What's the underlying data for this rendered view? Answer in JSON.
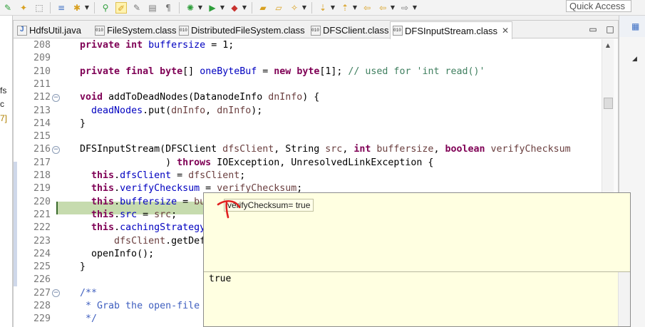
{
  "toolbar": {
    "quick_access_label": "Quick Access"
  },
  "left_panel": {
    "items": [
      "fs",
      "c",
      "7]"
    ]
  },
  "tabs": [
    {
      "label": "HdfsUtil.java",
      "kind": "java",
      "active": false
    },
    {
      "label": "FileSystem.class",
      "kind": "class",
      "active": false
    },
    {
      "label": "DistributedFileSystem.class",
      "kind": "class",
      "active": false
    },
    {
      "label": "DFSClient.class",
      "kind": "class",
      "active": false
    },
    {
      "label": "DFSInputStream.class",
      "kind": "class",
      "active": true,
      "close": "✕"
    }
  ],
  "editor": {
    "line_numbers": [
      "208",
      "209",
      "210",
      "211",
      "212",
      "213",
      "214",
      "215",
      "216",
      "217",
      "218",
      "219",
      "220",
      "221",
      "222",
      "223",
      "224",
      "225",
      "226",
      "227",
      "228",
      "229"
    ],
    "folded_lines": [
      "212",
      "216",
      "227"
    ],
    "highlighted_line": "219",
    "lines": [
      [
        {
          "t": "  "
        },
        {
          "t": "private",
          "c": "kw"
        },
        {
          "t": " "
        },
        {
          "t": "int",
          "c": "kw"
        },
        {
          "t": " "
        },
        {
          "t": "buffersize",
          "c": "fld"
        },
        {
          "t": " = 1;"
        }
      ],
      [
        {
          "t": ""
        }
      ],
      [
        {
          "t": "  "
        },
        {
          "t": "private",
          "c": "kw"
        },
        {
          "t": " "
        },
        {
          "t": "final",
          "c": "kw"
        },
        {
          "t": " "
        },
        {
          "t": "byte",
          "c": "kw"
        },
        {
          "t": "[] "
        },
        {
          "t": "oneByteBuf",
          "c": "fld"
        },
        {
          "t": " = "
        },
        {
          "t": "new",
          "c": "kw"
        },
        {
          "t": " "
        },
        {
          "t": "byte",
          "c": "kw"
        },
        {
          "t": "[1]; "
        },
        {
          "t": "// used for 'int read()'",
          "c": "cmt"
        }
      ],
      [
        {
          "t": ""
        }
      ],
      [
        {
          "t": "  "
        },
        {
          "t": "void",
          "c": "kw"
        },
        {
          "t": " addToDeadNodes(DatanodeInfo "
        },
        {
          "t": "dnInfo",
          "c": "prm"
        },
        {
          "t": ") {"
        }
      ],
      [
        {
          "t": "    "
        },
        {
          "t": "deadNodes",
          "c": "fld"
        },
        {
          "t": ".put("
        },
        {
          "t": "dnInfo",
          "c": "prm"
        },
        {
          "t": ", "
        },
        {
          "t": "dnInfo",
          "c": "prm"
        },
        {
          "t": ");"
        }
      ],
      [
        {
          "t": "  }"
        }
      ],
      [
        {
          "t": ""
        }
      ],
      [
        {
          "t": "  DFSInputStream(DFSClient "
        },
        {
          "t": "dfsClient",
          "c": "prm"
        },
        {
          "t": ", String "
        },
        {
          "t": "src",
          "c": "prm"
        },
        {
          "t": ", "
        },
        {
          "t": "int",
          "c": "kw"
        },
        {
          "t": " "
        },
        {
          "t": "buffersize",
          "c": "prm"
        },
        {
          "t": ", "
        },
        {
          "t": "boolean",
          "c": "kw"
        },
        {
          "t": " "
        },
        {
          "t": "verifyChecksum",
          "c": "prm"
        }
      ],
      [
        {
          "t": "                 ) "
        },
        {
          "t": "throws",
          "c": "kw"
        },
        {
          "t": " IOException, UnresolvedLinkException {"
        }
      ],
      [
        {
          "t": "    "
        },
        {
          "t": "this",
          "c": "kw"
        },
        {
          "t": "."
        },
        {
          "t": "dfsClient",
          "c": "fld"
        },
        {
          "t": " = "
        },
        {
          "t": "dfsClient",
          "c": "prm"
        },
        {
          "t": ";"
        }
      ],
      [
        {
          "t": "    "
        },
        {
          "t": "this",
          "c": "kw"
        },
        {
          "t": "."
        },
        {
          "t": "verifyChecksum",
          "c": "fld"
        },
        {
          "t": " = "
        },
        {
          "t": "verifyChecksum",
          "c": "prm"
        },
        {
          "t": ";"
        }
      ],
      [
        {
          "t": "    "
        },
        {
          "t": "this",
          "c": "kw"
        },
        {
          "t": "."
        },
        {
          "t": "buffersize",
          "c": "fld"
        },
        {
          "t": " = "
        },
        {
          "t": "buff",
          "c": "prm"
        }
      ],
      [
        {
          "t": "    "
        },
        {
          "t": "this",
          "c": "kw"
        },
        {
          "t": "."
        },
        {
          "t": "src",
          "c": "fld"
        },
        {
          "t": " = "
        },
        {
          "t": "src",
          "c": "prm"
        },
        {
          "t": ";"
        }
      ],
      [
        {
          "t": "    "
        },
        {
          "t": "this",
          "c": "kw"
        },
        {
          "t": "."
        },
        {
          "t": "cachingStrategy",
          "c": "fld"
        },
        {
          "t": " ="
        }
      ],
      [
        {
          "t": "        "
        },
        {
          "t": "dfsClient",
          "c": "prm"
        },
        {
          "t": ".getDefa"
        }
      ],
      [
        {
          "t": "    openInfo();"
        }
      ],
      [
        {
          "t": "  }"
        }
      ],
      [
        {
          "t": ""
        }
      ],
      [
        {
          "t": "  "
        },
        {
          "t": "/**",
          "c": "jd"
        }
      ],
      [
        {
          "t": "   * Grab the open-file in",
          "c": "jd"
        }
      ],
      [
        {
          "t": "   */",
          "c": "jd"
        }
      ]
    ]
  },
  "popup": {
    "expression": "verifyChecksum= true",
    "value": "true"
  },
  "colors": {
    "keyword": "#7f0055",
    "field": "#0000c0",
    "comment": "#3f7f5f",
    "javadoc": "#3f5fbf",
    "current_line": "#c6dbae",
    "popup_bg": "#ffffe1",
    "annotation": "#e02020"
  }
}
